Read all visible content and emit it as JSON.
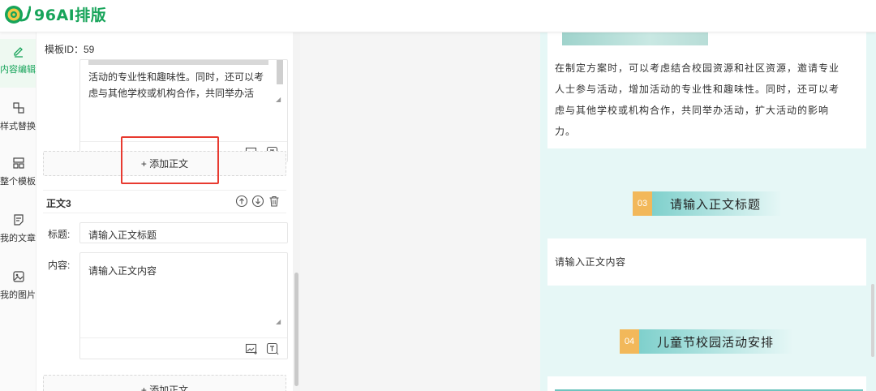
{
  "app": {
    "logo_text": "96AI排版"
  },
  "sidebar": {
    "items": [
      {
        "label": "内容编辑",
        "icon": "edit-icon",
        "active": true
      },
      {
        "label": "样式替换",
        "icon": "replace-icon",
        "active": false
      },
      {
        "label": "整个模板",
        "icon": "layout-icon",
        "active": false
      },
      {
        "label": "我的文章",
        "icon": "article-icon",
        "active": false
      },
      {
        "label": "我的图片",
        "icon": "image-icon",
        "active": false
      }
    ]
  },
  "editor": {
    "template_id": "模板ID：59",
    "prev_section": {
      "content_lines": [
        "活动的专业性和趣味性。同时，还可以考",
        "虑与其他学校或机构合作，共同举办活"
      ]
    },
    "add_body_label": "+ 添加正文",
    "section3": {
      "title": "正文3",
      "title_label": "标题:",
      "title_placeholder": "请输入正文标题",
      "content_label": "内容:",
      "content_placeholder": "请输入正文内容"
    },
    "add_body_label_2": "+ 添加正文"
  },
  "preview": {
    "paragraph_lines": [
      "在制定方案时，可以考虑结合校园资源和社区资源，邀请专业",
      "人士参与活动，增加活动的专业性和趣味性。同时，还可以考",
      "虑与其他学校或机构合作，共同举办活动，扩大活动的影响",
      "力。"
    ],
    "heading3": {
      "num": "03",
      "text": "请输入正文标题"
    },
    "body3": "请输入正文内容",
    "heading4": {
      "num": "04",
      "text": "儿童节校园活动安排"
    }
  },
  "colors": {
    "brand_green": "#17a45a",
    "highlight_red": "#e83a30",
    "preview_bg": "#e6f7f6",
    "heading_num_orange": "#f2b85a"
  }
}
